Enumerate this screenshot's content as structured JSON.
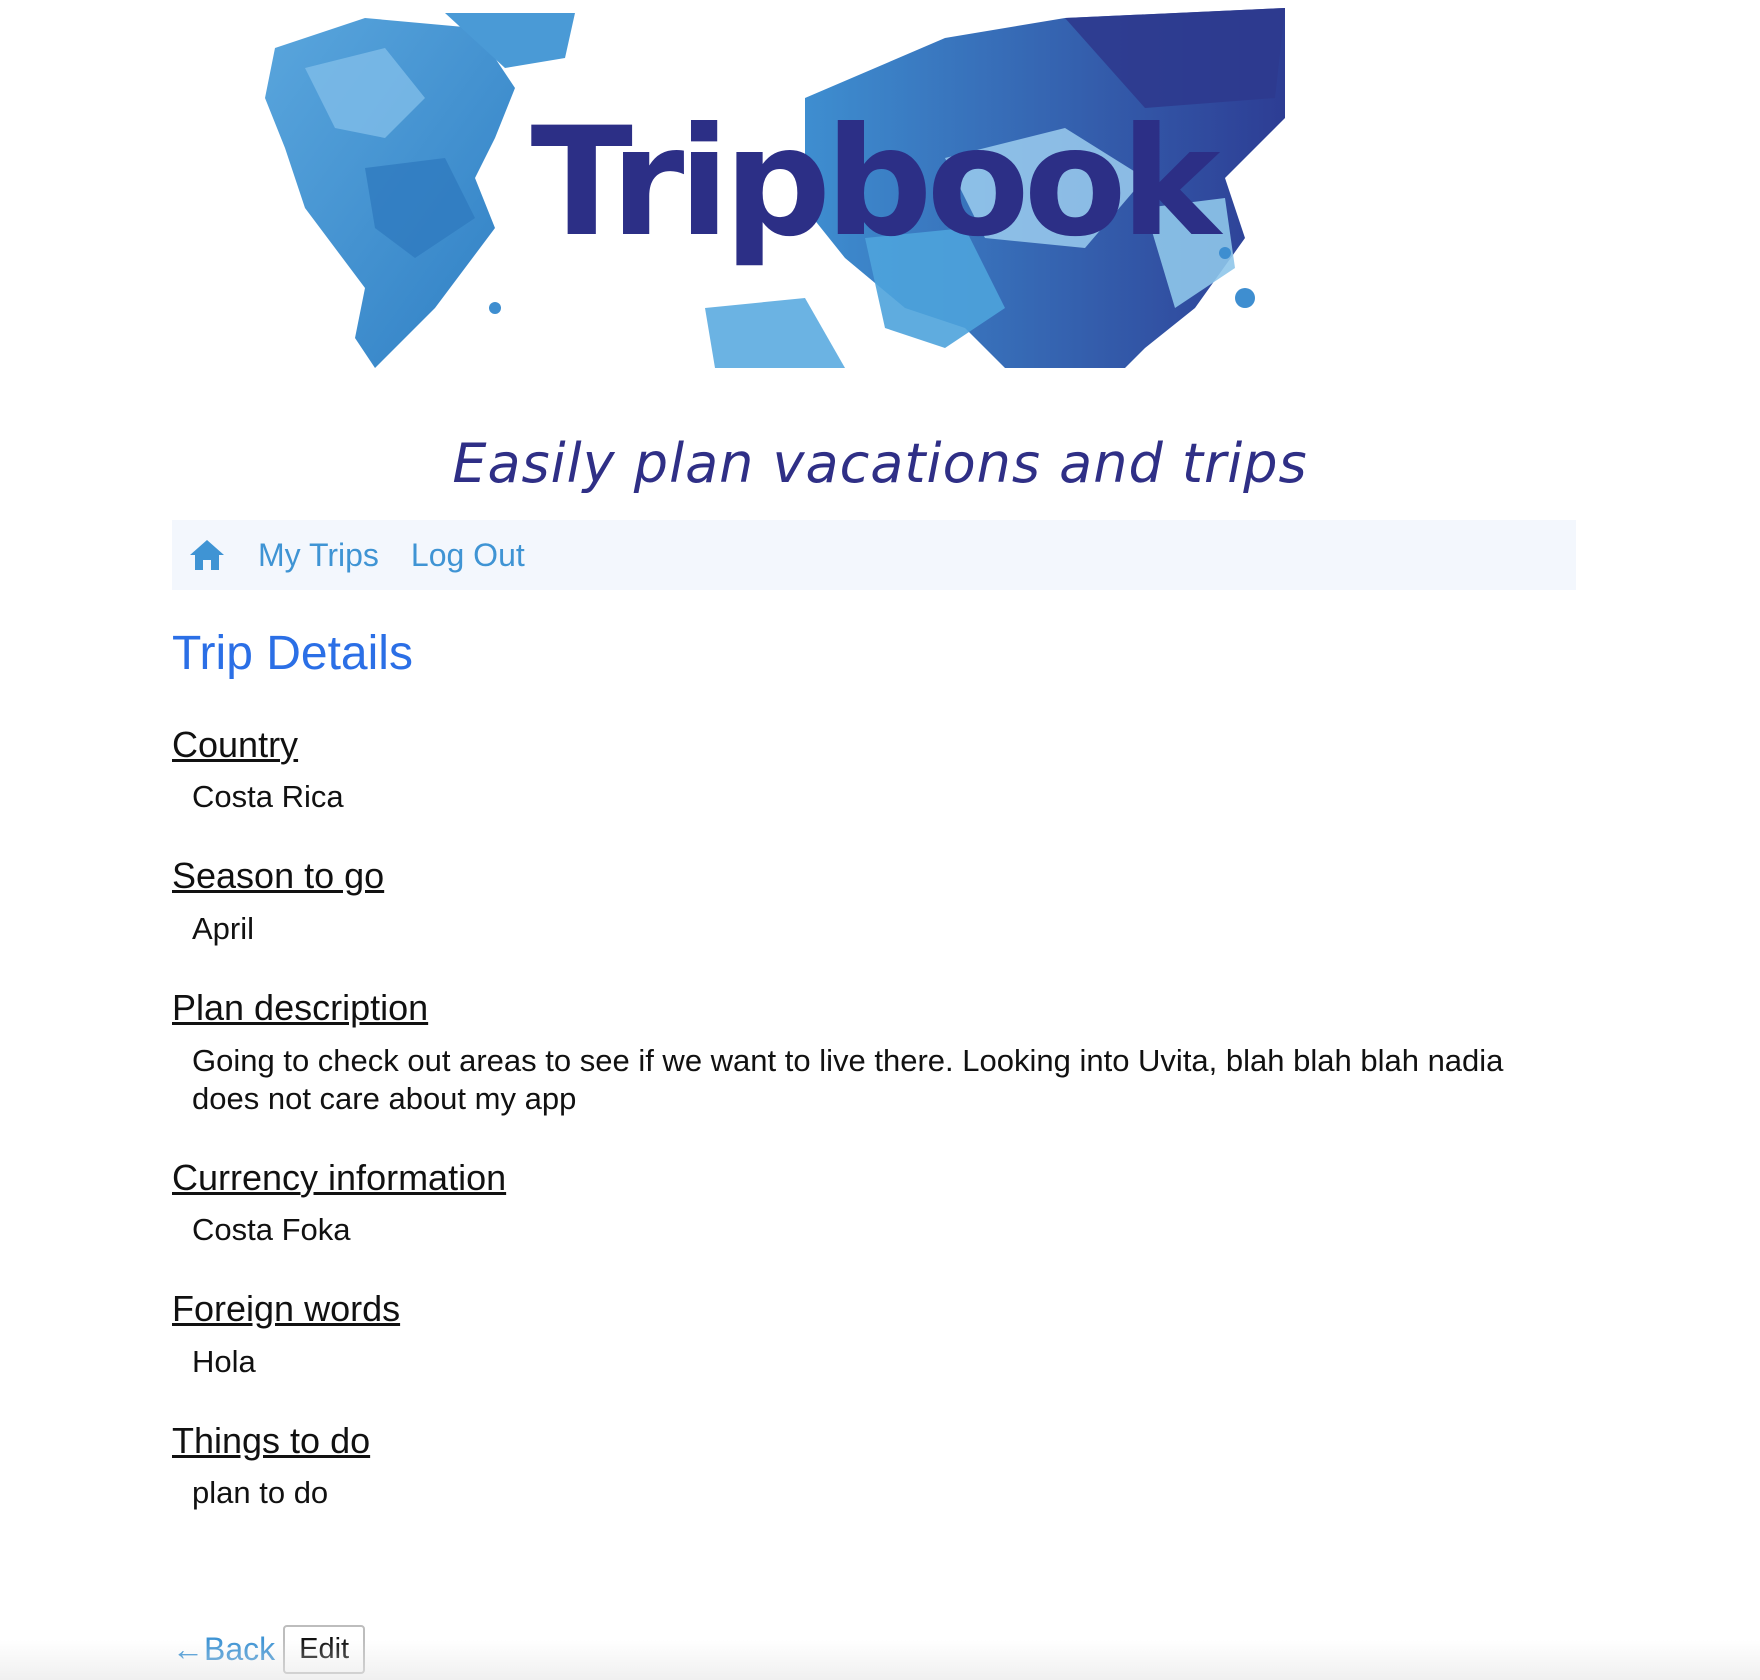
{
  "header": {
    "logo_text": "Tripbook",
    "tagline": "Easily plan vacations and trips"
  },
  "nav": {
    "home_icon": "home-icon",
    "links": [
      "My Trips",
      "Log Out"
    ]
  },
  "page": {
    "title": "Trip Details"
  },
  "fields": [
    {
      "label": "Country",
      "value": "Costa Rica"
    },
    {
      "label": "Season to go",
      "value": "April"
    },
    {
      "label": "Plan description",
      "value": "Going to check out areas to see if we want to live there. Looking into Uvita, blah blah blah nadia does not care about my app"
    },
    {
      "label": "Currency information",
      "value": "Costa Foka"
    },
    {
      "label": "Foreign words",
      "value": "Hola"
    },
    {
      "label": "Things to do",
      "value": "plan to do"
    }
  ],
  "actions": {
    "back_label": "←Back",
    "edit_label": "Edit"
  },
  "colors": {
    "logo": "#2c2f86",
    "link": "#3f94d4",
    "title": "#2b6fe6",
    "nav_bg": "#f3f7fd",
    "map_light": "#8cc4ea",
    "map_mid": "#3d8fd0",
    "map_dark": "#2b3a8f"
  }
}
